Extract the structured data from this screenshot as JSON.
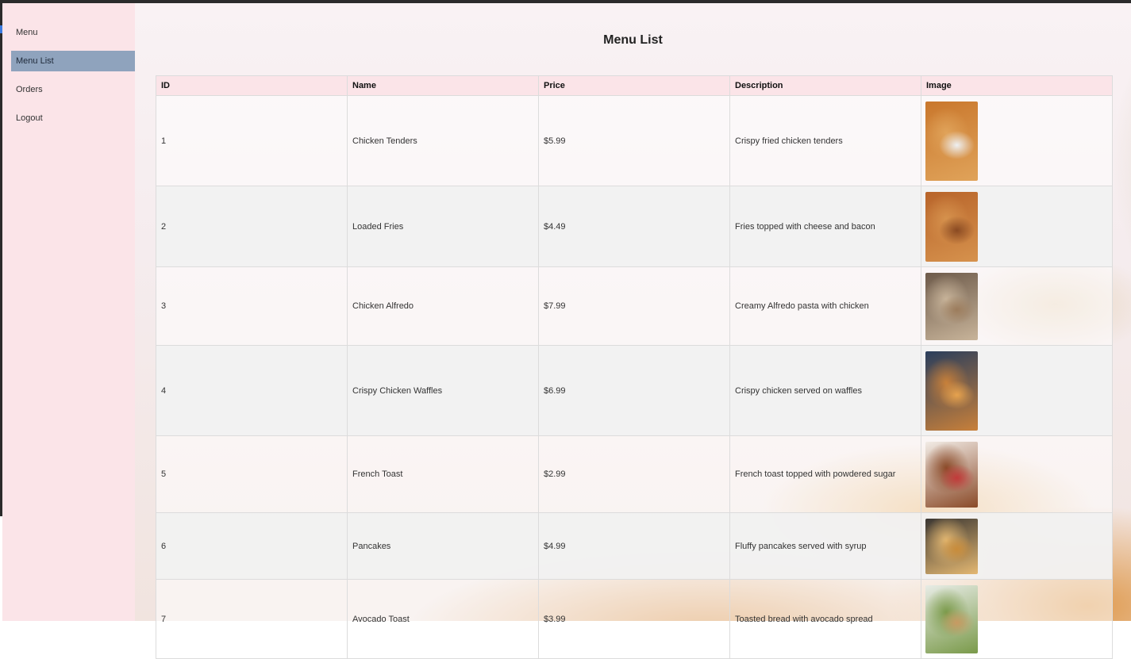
{
  "sidebar": {
    "items": [
      {
        "label": "Menu"
      },
      {
        "label": "Menu List"
      },
      {
        "label": "Orders"
      },
      {
        "label": "Logout"
      }
    ]
  },
  "page": {
    "title": "Menu List"
  },
  "table": {
    "headers": [
      "ID",
      "Name",
      "Price",
      "Description",
      "Image"
    ],
    "rows": [
      {
        "id": "1",
        "name": "Chicken Tenders",
        "price": "$5.99",
        "description": "Crispy fried chicken tenders",
        "image": "chicken-tenders-photo",
        "colors": [
          "#c9772c",
          "#e0a35a",
          "#eef0f2"
        ]
      },
      {
        "id": "2",
        "name": "Loaded Fries",
        "price": "$4.49",
        "description": "Fries topped with cheese and bacon",
        "image": "loaded-fries-photo",
        "colors": [
          "#b8642a",
          "#d6924d",
          "#8a4a22"
        ]
      },
      {
        "id": "3",
        "name": "Chicken Alfredo",
        "price": "$7.99",
        "description": "Creamy Alfredo pasta with chicken",
        "image": "chicken-alfredo-photo",
        "colors": [
          "#6d5a4a",
          "#c8b49a",
          "#9c7c5c"
        ]
      },
      {
        "id": "4",
        "name": "Crispy Chicken Waffles",
        "price": "$6.99",
        "description": "Crispy chicken served on waffles",
        "image": "chicken-waffles-photo",
        "colors": [
          "#2a3e5c",
          "#c8803a",
          "#e6a24e"
        ]
      },
      {
        "id": "5",
        "name": "French Toast",
        "price": "$2.99",
        "description": "French toast topped with powdered sugar",
        "image": "french-toast-photo",
        "colors": [
          "#f2ece6",
          "#8a4a28",
          "#c23a3a"
        ]
      },
      {
        "id": "6",
        "name": "Pancakes",
        "price": "$4.99",
        "description": "Fluffy pancakes served with syrup",
        "image": "pancakes-photo",
        "colors": [
          "#3a3632",
          "#e4b872",
          "#c98c3a"
        ]
      },
      {
        "id": "7",
        "name": "Avocado Toast",
        "price": "$3.99",
        "description": "Toasted bread with avocado spread",
        "image": "avocado-toast-photo",
        "colors": [
          "#e8ece6",
          "#7a9a4a",
          "#c89a62"
        ]
      }
    ]
  }
}
